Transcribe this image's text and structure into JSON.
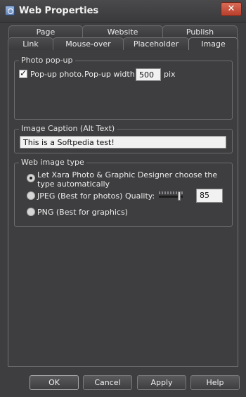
{
  "window": {
    "title": "Web Properties",
    "close_glyph": "✕"
  },
  "tabs": {
    "back_row": [
      "Page",
      "Website",
      "Publish"
    ],
    "front_row": [
      "Link",
      "Mouse-over",
      "Placeholder",
      "Image"
    ],
    "active": "Image"
  },
  "photo_popup": {
    "legend": "Photo pop-up",
    "checkbox_label": "Pop-up photo.",
    "width_label": "Pop-up width:",
    "width_value": "500",
    "unit": "pix",
    "checked": true
  },
  "caption": {
    "legend": "Image Caption (Alt Text)",
    "value": "This is a Softpedia test!"
  },
  "web_image_type": {
    "legend": "Web image type",
    "options": [
      "Let Xara Photo & Graphic Designer choose the type automatically",
      "JPEG (Best for photos)",
      "PNG (Best for graphics)"
    ],
    "selected_index": 0,
    "quality_label": "Quality:",
    "quality_value": "85"
  },
  "buttons": {
    "ok": "OK",
    "cancel": "Cancel",
    "apply": "Apply",
    "help": "Help"
  }
}
